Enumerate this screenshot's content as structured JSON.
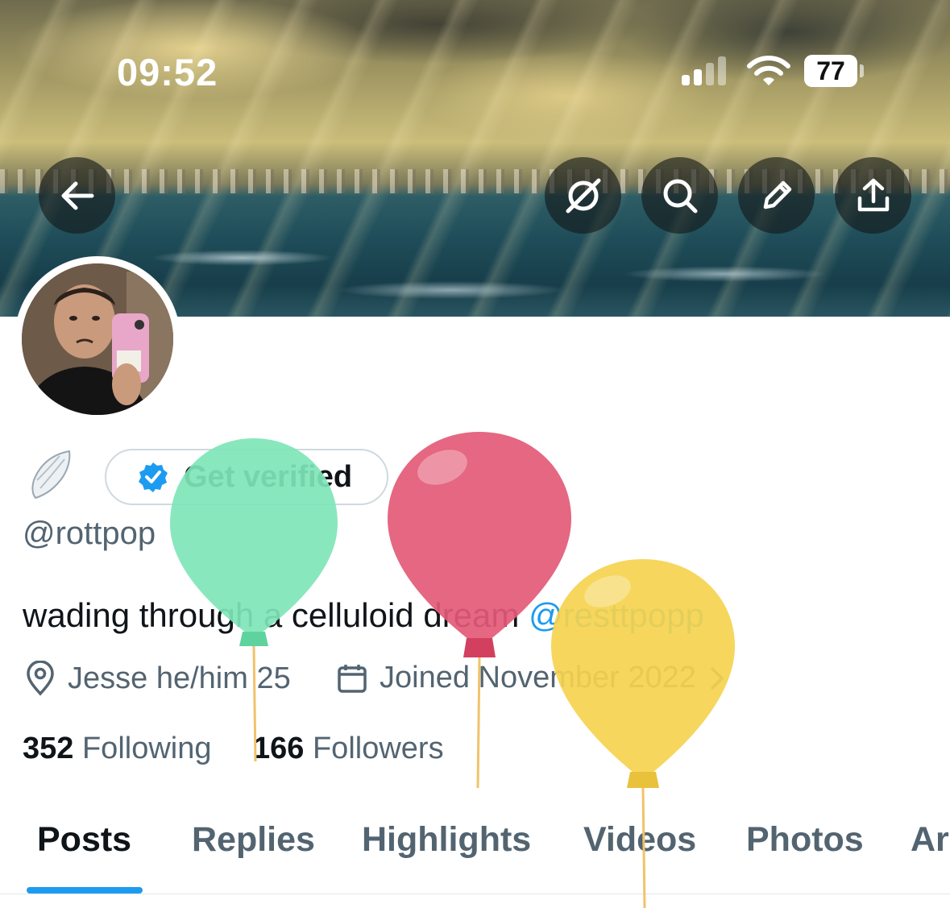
{
  "status_bar": {
    "time": "09:52",
    "battery": "77"
  },
  "header_buttons": {
    "back": "arrow-left-icon",
    "grok": "grok-icon",
    "search": "search-icon",
    "edit": "pencil-icon",
    "share": "share-icon"
  },
  "profile": {
    "get_verified_label": "Get verified",
    "handle": "@rottpop",
    "bio": "wading through a celluloid dream ",
    "bio_mention": "@resttpopp",
    "location": "Jesse he/him 25",
    "joined": "Joined November 2022",
    "following_count": "352",
    "following_label": "Following",
    "followers_count": "166",
    "followers_label": "Followers"
  },
  "tabs": [
    {
      "label": "Posts",
      "active": true
    },
    {
      "label": "Replies",
      "active": false
    },
    {
      "label": "Highlights",
      "active": false
    },
    {
      "label": "Videos",
      "active": false
    },
    {
      "label": "Photos",
      "active": false
    },
    {
      "label": "Ar",
      "active": false
    }
  ],
  "colors": {
    "accent": "#1d9bf0",
    "balloon_green": "#7fe5b8",
    "balloon_red": "#e35a77",
    "balloon_yellow": "#f5d34e"
  }
}
